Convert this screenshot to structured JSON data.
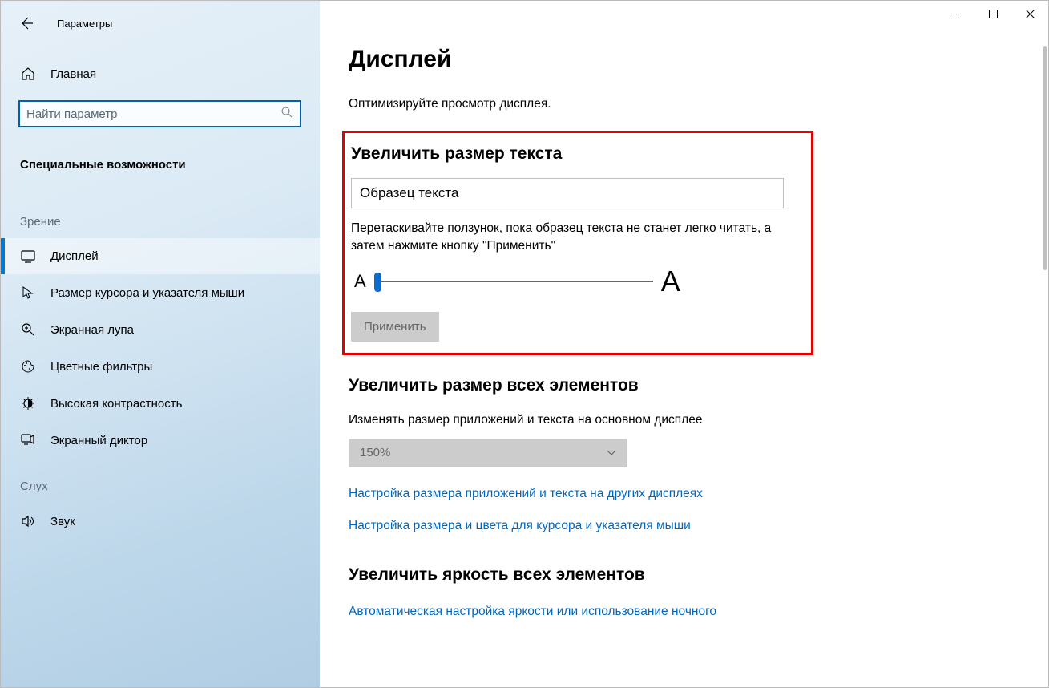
{
  "app_title": "Параметры",
  "sidebar": {
    "home": "Главная",
    "search_placeholder": "Найти параметр",
    "category": "Специальные возможности",
    "group_vision": "Зрение",
    "group_hearing": "Слух",
    "items": {
      "display": "Дисплей",
      "cursor": "Размер курсора и указателя мыши",
      "magnifier": "Экранная лупа",
      "colorfilters": "Цветные фильтры",
      "highcontrast": "Высокая контрастность",
      "narrator": "Экранный диктор",
      "audio": "Звук"
    }
  },
  "main": {
    "title": "Дисплей",
    "subtitle": "Оптимизируйте просмотр дисплея.",
    "textsize": {
      "heading": "Увеличить размер текста",
      "sample": "Образец текста",
      "instruction": "Перетаскивайте ползунок, пока образец текста не станет легко читать, а затем нажмите кнопку \"Применить\"",
      "small_a": "A",
      "big_a": "A",
      "apply": "Применить"
    },
    "scale": {
      "heading": "Увеличить размер всех элементов",
      "desc": "Изменять размер приложений и текста на основном дисплее",
      "value": "150%",
      "link1": "Настройка размера приложений и текста на других дисплеях",
      "link2": "Настройка размера и цвета для курсора и указателя мыши"
    },
    "brightness": {
      "heading": "Увеличить яркость всех элементов",
      "link": "Автоматическая настройка яркости или использование ночного"
    }
  }
}
